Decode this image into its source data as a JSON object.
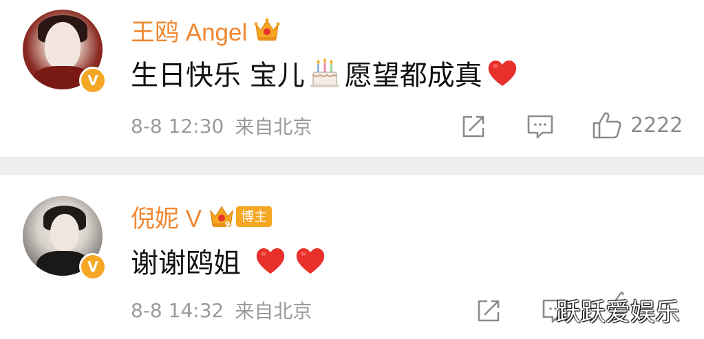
{
  "comments": [
    {
      "username": "王鸥 Angel",
      "content": {
        "text_before": "生日快乐 宝儿",
        "emoji_1": "cake-emoji",
        "text_after": "愿望都成真",
        "emoji_2": "red-heart-emoji"
      },
      "date": "8-8 12:30",
      "source": "来自北京",
      "likes": "2222",
      "verified_badge": "V"
    },
    {
      "username": "倪妮 V",
      "blogger_tag": "博主",
      "content": {
        "text": "谢谢鸥姐",
        "emoji_1": "red-heart-emoji",
        "emoji_2": "red-heart-emoji"
      },
      "date": "8-8 14:32",
      "source": "来自北京",
      "verified_badge": "V"
    }
  ],
  "watermark": "跃跃爱娱乐",
  "colors": {
    "username": "#f08731",
    "meta": "#9a9a9a",
    "badge": "#f5a623",
    "heart": "#e8312b",
    "divider": "#efefef"
  },
  "icons": {
    "share": "share-icon",
    "comment": "comment-icon",
    "like": "thumbs-up-icon",
    "crown": "crown-icon"
  }
}
